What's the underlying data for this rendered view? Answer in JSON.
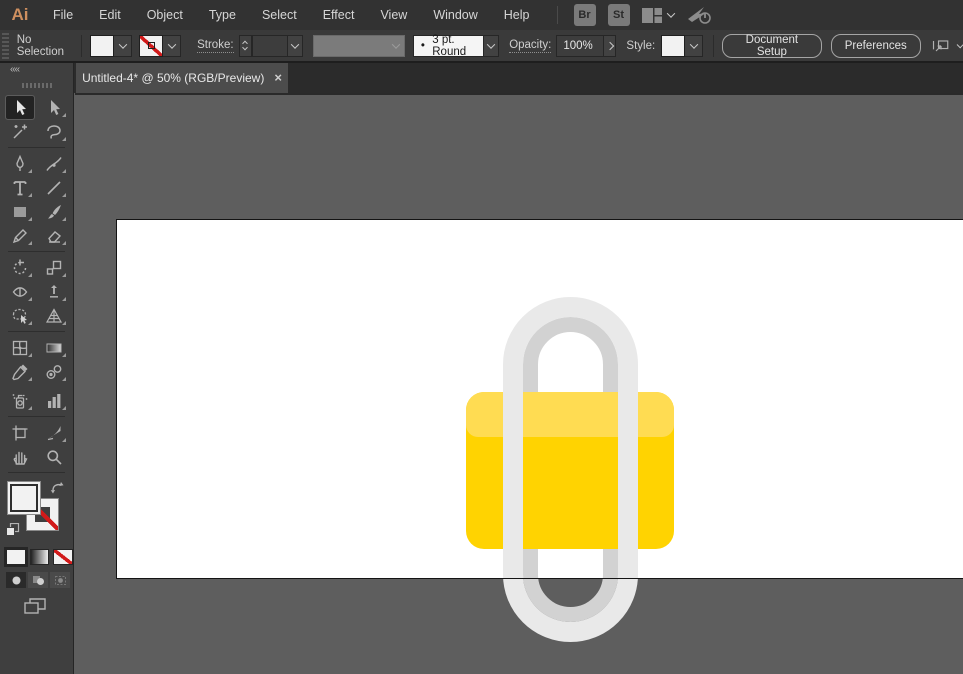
{
  "menu_bar": {
    "logo": "Ai",
    "items": [
      "File",
      "Edit",
      "Object",
      "Type",
      "Select",
      "Effect",
      "View",
      "Window",
      "Help"
    ],
    "bridge_button": "Br",
    "stock_button": "St"
  },
  "control_bar": {
    "selection_status": "No Selection",
    "stroke_label": "Stroke:",
    "brush_bullet": "•",
    "brush_value": "3 pt. Round",
    "opacity_label": "Opacity:",
    "opacity_value": "100%",
    "style_label": "Style:",
    "document_setup_button": "Document Setup",
    "preferences_button": "Preferences"
  },
  "tab_bar": {
    "active_tab_title": "Untitled-4* @ 50% (RGB/Preview)",
    "close_glyph": "×"
  },
  "toolbar": {
    "collapse_glyph": "««",
    "tools": [
      "selection",
      "direct-selection",
      "magic-wand",
      "lasso",
      "pen",
      "curvature",
      "type",
      "line-segment",
      "rectangle",
      "paintbrush",
      "pencil",
      "eraser",
      "rotate",
      "scale",
      "width",
      "puppet-warp",
      "shape-builder",
      "perspective-grid",
      "mesh",
      "gradient",
      "eyedropper",
      "blend",
      "symbol-sprayer",
      "column-graph",
      "artboard",
      "slice",
      "hand",
      "zoom"
    ]
  },
  "artwork": {
    "description": "Lock-shaped flat logo: yellow rounded body with lighter top band and gray stadium-shaped shackle ring overlapping the artboard edge",
    "body_color": "#FFD301",
    "body_highlight_color": "#FFDC52",
    "ring_outer_color": "#E9E9E9",
    "ring_inner_color": "#D2D2D2"
  },
  "colors": {
    "pasteboard": "#5E5E5E",
    "artboard": "#FFFFFF",
    "menu_bar_bg": "#323232",
    "control_bar_bg": "#3A3A3A",
    "tab_active_bg": "#4C4C4C",
    "toolbar_bg": "#3F3F3F",
    "none_slash_red": "#D11A1A"
  }
}
